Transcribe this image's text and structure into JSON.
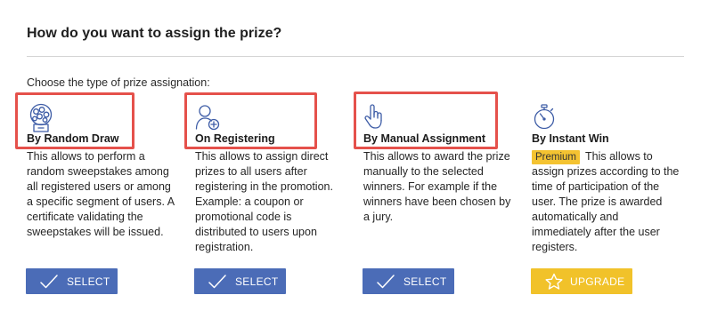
{
  "header": {
    "title": "How do you want to assign the prize?",
    "subtitle": "Choose the type of prize assignation:"
  },
  "colors": {
    "primary_button": "#4b6cb7",
    "upgrade_button": "#f1c22a",
    "premium_badge": "#f4c331",
    "icon_stroke": "#3d5ca6",
    "highlight_box": "#e5514b",
    "divider": "#d4d4d4"
  },
  "options": [
    {
      "icon": "gumball-machine-icon",
      "title": "By Random Draw",
      "highlighted": true,
      "lines": [
        "This allows to perform a",
        "random sweepstakes among",
        "all registered users or among",
        "a specific segment of users. A",
        "certificate validating the",
        "sweepstakes will be issued."
      ],
      "button": {
        "label": "SELECT",
        "icon": "check-icon"
      }
    },
    {
      "icon": "person-add-icon",
      "title": "On Registering",
      "highlighted": true,
      "lines": [
        "This allows to assign direct",
        "prizes to all users after",
        "registering in the promotion.",
        "Example: a coupon or",
        "promotional code is",
        "distributed to users upon",
        "registration."
      ],
      "button": {
        "label": "SELECT",
        "icon": "check-icon"
      }
    },
    {
      "icon": "raised-hand-icon",
      "title": "By Manual Assignment",
      "highlighted": true,
      "lines": [
        "This allows to award the prize",
        "manually to the selected",
        "winners. For example if the",
        "winners have been chosen by",
        "a jury."
      ],
      "button": {
        "label": "SELECT",
        "icon": "check-icon"
      }
    },
    {
      "icon": "stopwatch-icon",
      "title": "By Instant Win",
      "highlighted": false,
      "badge": "Premium",
      "lines": [
        "This allows to",
        "assign prizes according to the",
        "time of participation of the",
        "user. The prize is awarded",
        "automatically and",
        "immediately after the user",
        "registers."
      ],
      "button": {
        "label": "UPGRADE",
        "icon": "star-icon"
      }
    }
  ]
}
